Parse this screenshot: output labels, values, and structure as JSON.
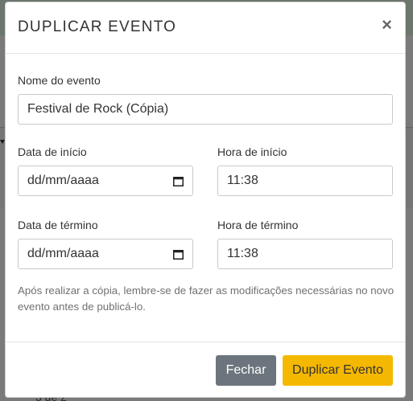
{
  "background": {
    "fragment_text": "3 de 2"
  },
  "modal": {
    "title": "DUPLICAR EVENTO",
    "close_glyph": "×",
    "event_name": {
      "label": "Nome do evento",
      "value": "Festival de Rock (Cópia)"
    },
    "start_date": {
      "label": "Data de início",
      "value": "dd/mm/aaaa",
      "icon": "calendar-icon"
    },
    "start_time": {
      "label": "Hora de início",
      "value": "11:38"
    },
    "end_date": {
      "label": "Data de término",
      "value": "dd/mm/aaaa",
      "icon": "calendar-icon"
    },
    "end_time": {
      "label": "Hora de término",
      "value": "11:38"
    },
    "info": "Após realizar a cópia, lembre-se de fazer as modificações necessárias no novo evento antes de publicá-lo.",
    "buttons": {
      "close": "Fechar",
      "duplicate": "Duplicar Evento"
    }
  },
  "colors": {
    "close_button": "#6c757d",
    "duplicate_button": "#f5b800"
  }
}
